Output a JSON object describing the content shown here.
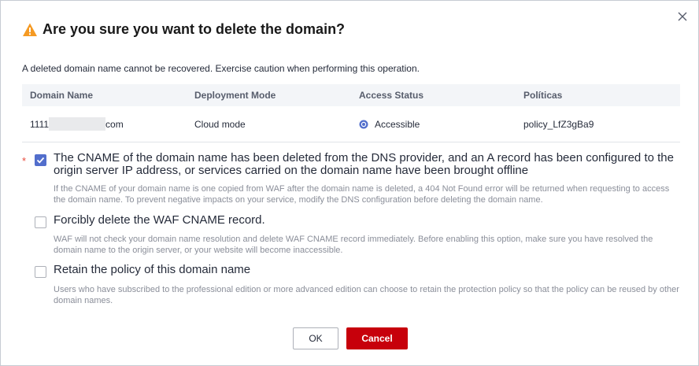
{
  "dialog": {
    "title": "Are you sure you want to delete the domain?",
    "description": "A deleted domain name cannot be recovered. Exercise caution when performing this operation.",
    "close_icon": "close-icon",
    "warning_icon": "warning-icon",
    "colors": {
      "warning": "#f59a23",
      "primary": "#526ecc",
      "danger": "#c7000b"
    }
  },
  "table": {
    "headers": [
      "Domain Name",
      "Deployment Mode",
      "Access Status",
      "Políticas"
    ],
    "row": {
      "domain_prefix": "1111",
      "domain_suffix": "com",
      "mode": "Cloud mode",
      "status": "Accessible",
      "policy": "policy_LfZ3gBa9"
    }
  },
  "options": [
    {
      "label": "The CNAME of the domain name has been deleted from the DNS provider, and an A record has been configured to the origin server IP address, or services carried on the domain name have been brought offline",
      "help": "If the CNAME of your domain name is one copied from WAF after the domain name is deleted, a 404 Not Found error will be returned when requesting to access the domain name. To prevent negative impacts on your service, modify the DNS configuration before deleting the domain name.",
      "required": "*",
      "checked": true
    },
    {
      "label": "Forcibly delete the WAF CNAME record.",
      "help": "WAF will not check your domain name resolution and delete WAF CNAME record immediately. Before enabling this option, make sure you have resolved the domain name to the origin server, or your website will become inaccessible.",
      "checked": false
    },
    {
      "label": "Retain the policy of this domain name",
      "help": "Users who have subscribed to the professional edition or more advanced edition can choose to retain the protection policy so that the policy can be reused by other domain names.",
      "checked": false
    }
  ],
  "buttons": {
    "ok": "OK",
    "cancel": "Cancel"
  }
}
